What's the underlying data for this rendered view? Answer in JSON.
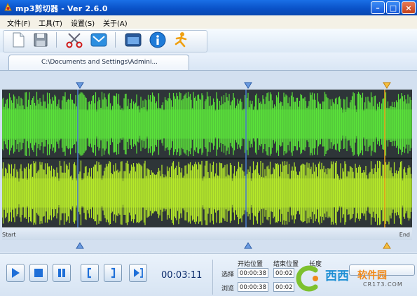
{
  "window": {
    "title": "mp3剪切器 - Ver 2.6.0",
    "minimize_label": "–",
    "maximize_label": "□",
    "close_label": "×"
  },
  "menu": {
    "items": [
      {
        "label": "文件(F)"
      },
      {
        "label": "工具(T)"
      },
      {
        "label": "设置(S)"
      },
      {
        "label": "关于(A)"
      }
    ]
  },
  "toolbar": {
    "icons": [
      "new-file-icon",
      "save-icon",
      "scissors-icon",
      "mail-icon",
      "window-icon",
      "info-icon",
      "runner-icon"
    ]
  },
  "tab": {
    "path": "C:\\Documents and Settings\\Admini..."
  },
  "waveform": {
    "start_label": "Start",
    "end_label": "End",
    "colors": {
      "background": "#2e3538",
      "channel_top": "#5be33a",
      "channel_bottom": "#b6ea2a",
      "marker_blue": "#4a7fd0",
      "marker_orange": "#f2a418"
    }
  },
  "player": {
    "buttons": [
      "play-icon",
      "stop-icon",
      "pause-icon",
      "mark-start-icon",
      "mark-end-icon",
      "play-selection-icon"
    ],
    "time": "00:03:11"
  },
  "selection": {
    "headers": {
      "start": "开始位置",
      "end": "结束位置",
      "length": "长度"
    },
    "rows": [
      {
        "label": "选择",
        "start": "00:00:38",
        "end": "00:02"
      },
      {
        "label": "浏览",
        "start": "00:00:38",
        "end": "00:02"
      }
    ]
  },
  "watermark": {
    "text_blue": "西西",
    "text_orange": "软件园",
    "url": "CR173.COM"
  }
}
